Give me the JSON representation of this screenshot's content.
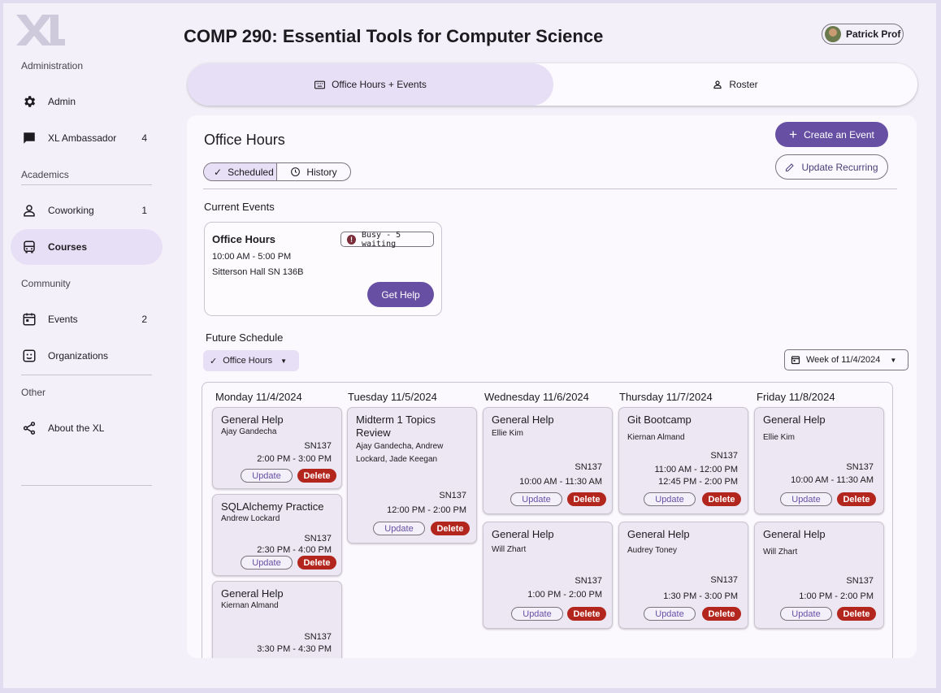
{
  "sidebar": {
    "sections": {
      "administration": "Administration",
      "academics": "Academics",
      "community": "Community",
      "other": "Other"
    },
    "items": [
      {
        "label": "Admin",
        "icon": "gear-icon",
        "count": ""
      },
      {
        "label": "XL Ambassador",
        "icon": "chat-icon",
        "count": "4"
      },
      {
        "label": "Coworking",
        "icon": "person-icon",
        "count": "1"
      },
      {
        "label": "Courses",
        "icon": "bus-icon",
        "count": ""
      },
      {
        "label": "Events",
        "icon": "calendar-icon",
        "count": "2"
      },
      {
        "label": "Organizations",
        "icon": "organization-icon",
        "count": ""
      },
      {
        "label": "About the XL",
        "icon": "share-icon",
        "count": ""
      }
    ]
  },
  "header": {
    "title": "COMP 290: Essential Tools for Computer Science",
    "user": "Patrick Prof"
  },
  "tabs": [
    {
      "label": "Office Hours + Events",
      "icon": "keyboard-icon"
    },
    {
      "label": "Roster",
      "icon": "person-icon"
    }
  ],
  "panel": {
    "title": "Office Hours",
    "create_label": "Create an Event",
    "update_recurring_label": "Update Recurring",
    "seg_scheduled": "Scheduled",
    "seg_history": "History",
    "current_events_label": "Current Events",
    "future_schedule_label": "Future Schedule",
    "filter_label": "Office Hours",
    "week_label": "Week of 11/4/2024"
  },
  "current_event": {
    "title": "Office Hours",
    "status": "Busy - 5 waiting",
    "time": "10:00 AM - 5:00 PM",
    "location": "Sitterson Hall SN 136B",
    "button": "Get Help"
  },
  "actions": {
    "update": "Update",
    "delete": "Delete"
  },
  "days": [
    {
      "label": "Monday 11/4/2024",
      "events": [
        {
          "title": "General Help",
          "hosts": "Ajay Gandecha",
          "room": "SN137",
          "times": [
            "2:00 PM - 3:00 PM"
          ]
        },
        {
          "title": "SQLAlchemy Practice",
          "hosts": "Andrew Lockard",
          "room": "SN137",
          "times": [
            "2:30 PM - 4:00 PM"
          ]
        },
        {
          "title": "General Help",
          "hosts": "Kiernan Almand",
          "room": "SN137",
          "times": [
            "3:30 PM - 4:30 PM"
          ]
        }
      ]
    },
    {
      "label": "Tuesday 11/5/2024",
      "events": [
        {
          "title": "Midterm 1 Topics Review",
          "hosts": "Ajay Gandecha, Andrew Lockard, Jade Keegan",
          "room": "SN137",
          "times": [
            "12:00 PM - 2:00 PM"
          ]
        }
      ]
    },
    {
      "label": "Wednesday 11/6/2024",
      "events": [
        {
          "title": "General Help",
          "hosts": "Ellie Kim",
          "room": "SN137",
          "times": [
            "10:00 AM - 11:30 AM"
          ]
        },
        {
          "title": "General Help",
          "hosts": "Will Zhart",
          "room": "SN137",
          "times": [
            "1:00 PM - 2:00 PM"
          ]
        }
      ]
    },
    {
      "label": "Thursday 11/7/2024",
      "events": [
        {
          "title": "Git Bootcamp",
          "hosts": "Kiernan Almand",
          "room": "SN137",
          "times": [
            "11:00 AM - 12:00 PM",
            "12:45 PM - 2:00 PM"
          ]
        },
        {
          "title": "General Help",
          "hosts": "Audrey Toney",
          "room": "SN137",
          "times": [
            "1:30 PM - 3:00 PM"
          ]
        }
      ]
    },
    {
      "label": "Friday 11/8/2024",
      "events": [
        {
          "title": "General Help",
          "hosts": "Ellie Kim",
          "room": "SN137",
          "times": [
            "10:00 AM - 11:30 AM"
          ]
        },
        {
          "title": "General Help",
          "hosts": "Will Zhart",
          "room": "SN137",
          "times": [
            "1:00 PM - 2:00 PM"
          ]
        }
      ]
    }
  ],
  "colors": {
    "primary": "#6750a4",
    "delete": "#b3261e",
    "active_bg": "#e6dff5"
  }
}
